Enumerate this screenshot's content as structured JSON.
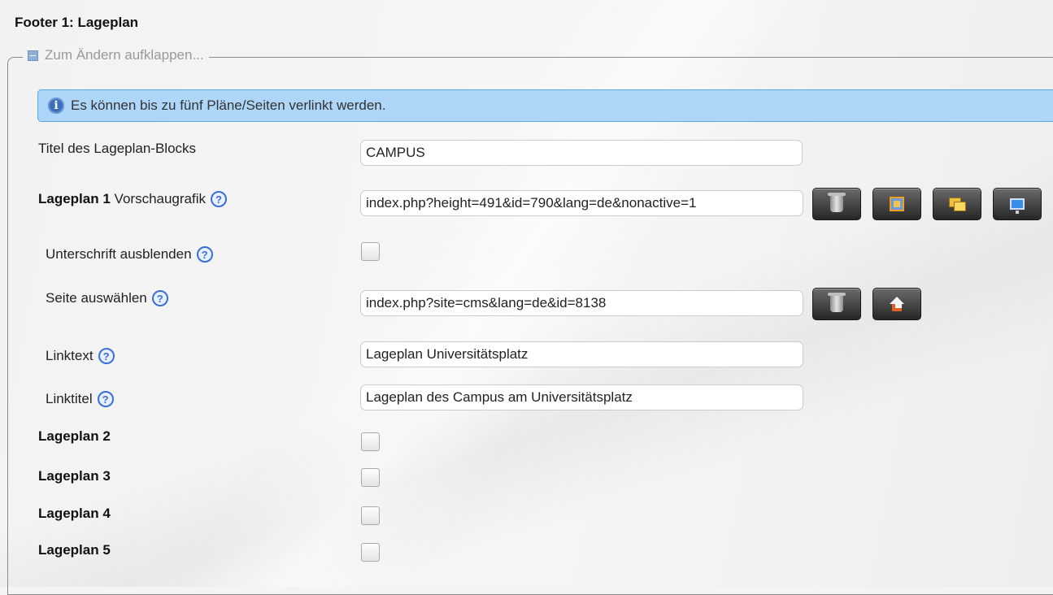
{
  "footer_title": "Footer 1: Lageplan",
  "legend": {
    "label": "Zum Ändern aufklappen..."
  },
  "info": {
    "text": "Es können bis zu fünf Pläne/Seiten verlinkt werden."
  },
  "fields": {
    "titel": {
      "label": "Titel des Lageplan-Blocks",
      "value": "CAMPUS"
    },
    "lageplan1": {
      "label_bold": "Lageplan 1",
      "label_rest": "Vorschaugrafik",
      "value": "index.php?height=491&id=790&lang=de&nonactive=1"
    },
    "unterschrift": {
      "label": "Unterschrift ausblenden",
      "checked": false
    },
    "seite": {
      "label": "Seite auswählen",
      "value": "index.php?site=cms&lang=de&id=8138"
    },
    "linktext": {
      "label": "Linktext",
      "value": "Lageplan Universitätsplatz"
    },
    "linktitel": {
      "label": "Linktitel",
      "value": "Lageplan des Campus am Universitätsplatz"
    }
  },
  "help_icon": "?",
  "info_icon": "i",
  "lageplaene": [
    {
      "label": "Lageplan 2",
      "checked": false
    },
    {
      "label": "Lageplan 3",
      "checked": false
    },
    {
      "label": "Lageplan 4",
      "checked": false
    },
    {
      "label": "Lageplan 5",
      "checked": false
    }
  ],
  "icons": {
    "collapse": "minus-icon",
    "info": "info-icon",
    "help": "help-icon",
    "trash": "trash-icon",
    "image": "image-icon",
    "windows": "windows-icon",
    "monitor": "monitor-icon",
    "home": "home-icon"
  },
  "colors": {
    "info_bg": "#aed6f8",
    "info_border": "#5ba8e5",
    "help": "#3b6fd8"
  }
}
